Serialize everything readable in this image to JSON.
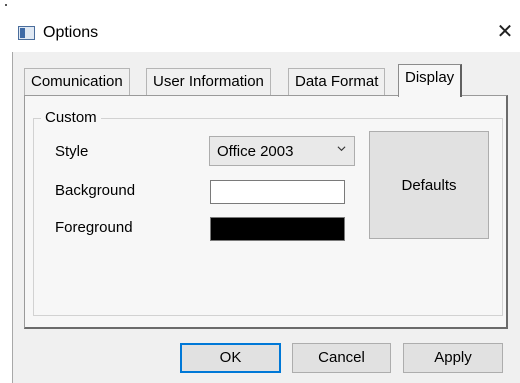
{
  "window": {
    "title": "Options",
    "close_glyph": "✕"
  },
  "tabs": [
    {
      "label": "Comunication",
      "selected": false
    },
    {
      "label": "User Information",
      "selected": false
    },
    {
      "label": "Data Format",
      "selected": false
    },
    {
      "label": "Display",
      "selected": true
    }
  ],
  "custom_group": {
    "title": "Custom",
    "style_label": "Style",
    "style_value": "Office 2003",
    "background_label": "Background",
    "background_color": "#ffffff",
    "foreground_label": "Foreground",
    "foreground_color": "#000000",
    "defaults_label": "Defaults"
  },
  "buttons": {
    "ok": "OK",
    "cancel": "Cancel",
    "apply": "Apply"
  },
  "colors": {
    "focus_accent": "#0078d7",
    "client_bg": "#f0f0f0"
  },
  "icons": {
    "app": "options-window-icon",
    "close": "close-icon",
    "dropdown": "chevron-down-icon"
  }
}
